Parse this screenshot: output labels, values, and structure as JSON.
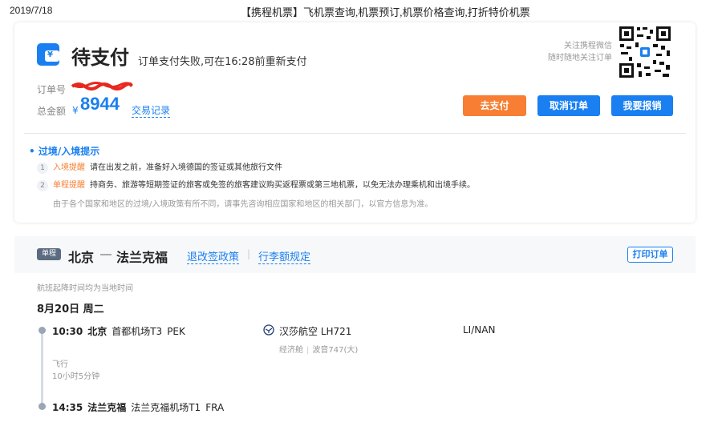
{
  "print_header": {
    "date": "2019/7/18",
    "title": "【携程机票】飞机票查询,机票预订,机票价格查询,打折特价机票"
  },
  "order": {
    "status_title": "待支付",
    "status_desc": "订单支付失败,可在16:28前重新支付",
    "order_no_label": "订单号",
    "total_label": "总金额",
    "currency_symbol": "¥",
    "total_amount": "8944",
    "transaction_link": "交易记录",
    "wechat_tip_line1": "关注携程微信",
    "wechat_tip_line2": "随时随地关注订单",
    "buttons": {
      "pay": "去支付",
      "cancel": "取消订单",
      "reimburse": "我要报销"
    }
  },
  "notice": {
    "title": "• 过境/入境提示",
    "items": [
      {
        "num": "1",
        "key": "入境提醒",
        "text": "请在出发之前，准备好入境德国的签证或其他旅行文件"
      },
      {
        "num": "2",
        "key": "单程提醒",
        "text": "持商务、旅游等短期签证的旅客或免签的旅客建议购买返程票或第三地机票，以免无法办理乘机和出境手续。"
      }
    ],
    "footer": "由于各个国家和地区的过境/入境政策有所不同，请事先咨询相应国家和地区的相关部门，以官方信息为准。"
  },
  "trip": {
    "badge": "单程",
    "from": "北京",
    "to": "法兰克福",
    "refund_policy_link": "退改签政策",
    "separator": "|",
    "baggage_link": "行李额规定",
    "print_button": "打印订单",
    "local_time_note": "航班起降时间均为当地时间",
    "date": "8月20日 周二",
    "departure": {
      "time": "10:30",
      "city": "北京",
      "airport": "首都机场T3",
      "code": "PEK"
    },
    "arrival": {
      "time": "14:35",
      "city": "法兰克福",
      "airport": "法兰克福机场T1",
      "code": "FRA"
    },
    "fly_label": "飞行",
    "duration": "10小时5分钟",
    "airline": "汉莎航空 LH721",
    "cabin_class": "经济舱",
    "cabin_sep": "|",
    "aircraft": "波音747(大)",
    "seat_info": "LI/NAN"
  },
  "colors": {
    "accent": "#1a7ff0",
    "pay_orange": "#f77e33"
  }
}
